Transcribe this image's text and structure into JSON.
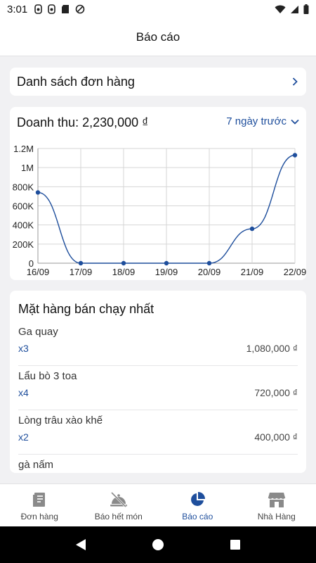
{
  "status_bar": {
    "time": "3:01"
  },
  "header": {
    "title": "Báo cáo"
  },
  "orders_card": {
    "label": "Danh sách đơn hàng"
  },
  "revenue": {
    "title": "Doanh thu: 2,230,000 ₫",
    "period": "7 ngày trước"
  },
  "chart_data": {
    "type": "line",
    "categories": [
      "16/09",
      "17/09",
      "18/09",
      "19/09",
      "20/09",
      "21/09",
      "22/09"
    ],
    "values": [
      740000,
      0,
      0,
      0,
      0,
      360000,
      1130000
    ],
    "y_ticks": [
      "0",
      "200K",
      "400K",
      "600K",
      "800K",
      "1M",
      "1.2M"
    ],
    "ylim": [
      0,
      1200000
    ],
    "grid": true,
    "line_color": "#1e4e9c"
  },
  "best_sellers": {
    "title": "Mặt hàng bán chạy nhất",
    "items": [
      {
        "name": "Ga quay",
        "qty": "x3",
        "amount": "1,080,000 ₫"
      },
      {
        "name": "Lẩu bò 3 toa",
        "qty": "x4",
        "amount": "720,000 ₫"
      },
      {
        "name": "Lòng trâu xào khế",
        "qty": "x2",
        "amount": "400,000 ₫"
      },
      {
        "name": "gà nấm",
        "qty": "",
        "amount": ""
      }
    ]
  },
  "bottom_nav": {
    "items": [
      {
        "label": "Đơn hàng",
        "icon": "receipt-icon"
      },
      {
        "label": "Báo hết món",
        "icon": "dish-off-icon"
      },
      {
        "label": "Báo cáo",
        "icon": "pie-chart-icon",
        "active": true
      },
      {
        "label": "Nhà Hàng",
        "icon": "store-icon"
      }
    ]
  },
  "colors": {
    "accent": "#1e4e9c",
    "inactive_icon": "#8a8a8a"
  }
}
